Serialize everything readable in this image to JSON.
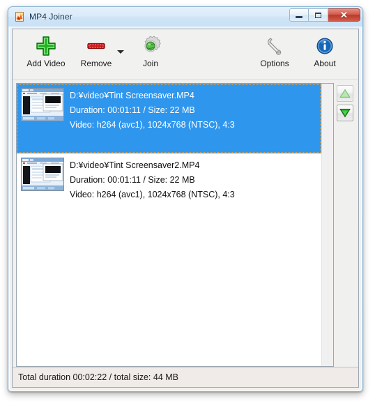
{
  "window": {
    "title": "MP4 Joiner",
    "app_icon": "mp4-joiner-app-icon",
    "controls": {
      "minimize": "–",
      "maximize": "□",
      "close": "✕"
    }
  },
  "toolbar": {
    "items": [
      {
        "label": "Add Video",
        "icon": "green-plus-icon"
      },
      {
        "label": "Remove",
        "icon": "red-minus-icon"
      },
      {
        "label": "Join",
        "icon": "gear-globe-icon"
      }
    ],
    "dropdown_caret": "chevron-down-icon",
    "right_items": [
      {
        "label": "Options",
        "icon": "wrench-icon"
      },
      {
        "label": "About",
        "icon": "info-circle-icon"
      }
    ]
  },
  "list": {
    "rows": [
      {
        "selected": true,
        "path": "D:¥video¥Tint Screensaver.MP4",
        "duration_line": "Duration: 00:01:11 / Size: 22 MB",
        "video_line": "Video: h264 (avc1), 1024x768 (NTSC), 4:3",
        "thumbnail": "video-thumbnail"
      },
      {
        "selected": false,
        "path": "D:¥video¥Tint Screensaver2.MP4",
        "duration_line": "Duration: 00:01:11 / Size: 22 MB",
        "video_line": "Video: h264 (avc1), 1024x768 (NTSC), 4:3",
        "thumbnail": "video-thumbnail"
      }
    ]
  },
  "order_buttons": {
    "move_up": {
      "icon": "arrow-up-icon",
      "enabled": false
    },
    "move_down": {
      "icon": "arrow-down-icon",
      "enabled": true
    }
  },
  "statusbar": {
    "text": "Total duration 00:02:22 / total size: 44 MB"
  },
  "colors": {
    "selection_blue": "#2f96ee",
    "title_blue": "#cfe4f6",
    "close_red": "#bc3827",
    "accent_green": "#1fa81f",
    "accent_red": "#cc1111",
    "about_blue": "#1b66b4"
  }
}
